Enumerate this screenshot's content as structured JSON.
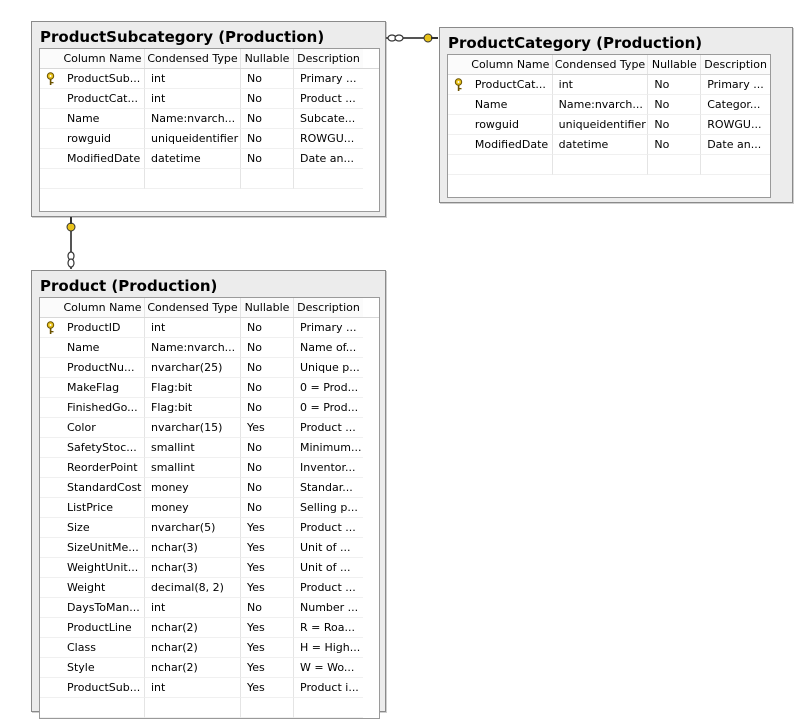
{
  "columns": [
    "Column Name",
    "Condensed Type",
    "Nullable",
    "Description"
  ],
  "tables": {
    "subcategory": {
      "title": "ProductSubcategory (Production)",
      "rows": [
        {
          "key": true,
          "name": "ProductSub...",
          "type": "int",
          "nullable": "No",
          "desc": "Primary ..."
        },
        {
          "key": false,
          "name": "ProductCat...",
          "type": "int",
          "nullable": "No",
          "desc": "Product ..."
        },
        {
          "key": false,
          "name": "Name",
          "type": "Name:nvarch...",
          "nullable": "No",
          "desc": "Subcate..."
        },
        {
          "key": false,
          "name": "rowguid",
          "type": "uniqueidentifier",
          "nullable": "No",
          "desc": "ROWGU..."
        },
        {
          "key": false,
          "name": "ModifiedDate",
          "type": "datetime",
          "nullable": "No",
          "desc": "Date an..."
        }
      ]
    },
    "category": {
      "title": "ProductCategory (Production)",
      "rows": [
        {
          "key": true,
          "name": "ProductCat...",
          "type": "int",
          "nullable": "No",
          "desc": "Primary ..."
        },
        {
          "key": false,
          "name": "Name",
          "type": "Name:nvarch...",
          "nullable": "No",
          "desc": "Categor..."
        },
        {
          "key": false,
          "name": "rowguid",
          "type": "uniqueidentifier",
          "nullable": "No",
          "desc": "ROWGU..."
        },
        {
          "key": false,
          "name": "ModifiedDate",
          "type": "datetime",
          "nullable": "No",
          "desc": "Date an..."
        }
      ]
    },
    "product": {
      "title": "Product (Production)",
      "rows": [
        {
          "key": true,
          "name": "ProductID",
          "type": "int",
          "nullable": "No",
          "desc": "Primary ..."
        },
        {
          "key": false,
          "name": "Name",
          "type": "Name:nvarch...",
          "nullable": "No",
          "desc": "Name of..."
        },
        {
          "key": false,
          "name": "ProductNu...",
          "type": "nvarchar(25)",
          "nullable": "No",
          "desc": "Unique p..."
        },
        {
          "key": false,
          "name": "MakeFlag",
          "type": "Flag:bit",
          "nullable": "No",
          "desc": "0 = Prod..."
        },
        {
          "key": false,
          "name": "FinishedGo...",
          "type": "Flag:bit",
          "nullable": "No",
          "desc": "0 = Prod..."
        },
        {
          "key": false,
          "name": "Color",
          "type": "nvarchar(15)",
          "nullable": "Yes",
          "desc": "Product ..."
        },
        {
          "key": false,
          "name": "SafetyStoc...",
          "type": "smallint",
          "nullable": "No",
          "desc": "Minimum..."
        },
        {
          "key": false,
          "name": "ReorderPoint",
          "type": "smallint",
          "nullable": "No",
          "desc": "Inventor..."
        },
        {
          "key": false,
          "name": "StandardCost",
          "type": "money",
          "nullable": "No",
          "desc": "Standar..."
        },
        {
          "key": false,
          "name": "ListPrice",
          "type": "money",
          "nullable": "No",
          "desc": "Selling p..."
        },
        {
          "key": false,
          "name": "Size",
          "type": "nvarchar(5)",
          "nullable": "Yes",
          "desc": "Product ..."
        },
        {
          "key": false,
          "name": "SizeUnitMe...",
          "type": "nchar(3)",
          "nullable": "Yes",
          "desc": "Unit of ..."
        },
        {
          "key": false,
          "name": "WeightUnit...",
          "type": "nchar(3)",
          "nullable": "Yes",
          "desc": "Unit of ..."
        },
        {
          "key": false,
          "name": "Weight",
          "type": "decimal(8, 2)",
          "nullable": "Yes",
          "desc": "Product ..."
        },
        {
          "key": false,
          "name": "DaysToMan...",
          "type": "int",
          "nullable": "No",
          "desc": "Number ..."
        },
        {
          "key": false,
          "name": "ProductLine",
          "type": "nchar(2)",
          "nullable": "Yes",
          "desc": "R = Roa..."
        },
        {
          "key": false,
          "name": "Class",
          "type": "nchar(2)",
          "nullable": "Yes",
          "desc": "H = High..."
        },
        {
          "key": false,
          "name": "Style",
          "type": "nchar(2)",
          "nullable": "Yes",
          "desc": "W = Wo..."
        },
        {
          "key": false,
          "name": "ProductSub...",
          "type": "int",
          "nullable": "Yes",
          "desc": "Product i..."
        }
      ]
    }
  },
  "colors": {
    "key": "#e8c21a",
    "line": "#555555",
    "panel": "#ececec"
  }
}
